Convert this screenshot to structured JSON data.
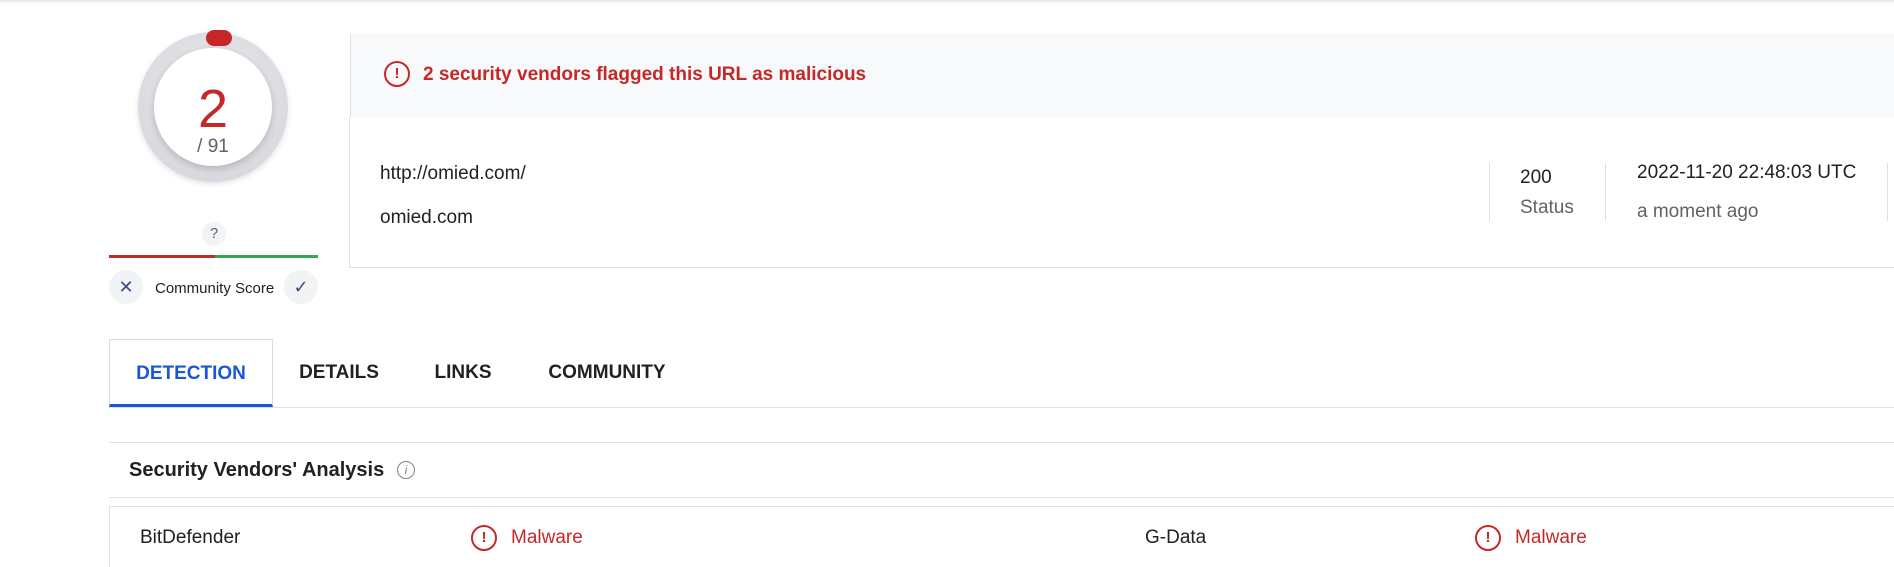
{
  "score": {
    "detections": "2",
    "total": "/ 91"
  },
  "community": {
    "unknown_mark": "?",
    "label": "Community Score",
    "vote_down_icon": "✕",
    "vote_up_icon": "✓"
  },
  "alert": {
    "icon": "!",
    "text": "2 security vendors flagged this URL as malicious"
  },
  "target": {
    "url": "http://omied.com/",
    "domain": "omied.com",
    "status_code": "200",
    "status_label": "Status",
    "date": "2022-11-20 22:48:03 UTC",
    "relative_time": "a moment ago"
  },
  "tabs": [
    {
      "label": "DETECTION",
      "active": true
    },
    {
      "label": "DETAILS",
      "active": false
    },
    {
      "label": "LINKS",
      "active": false
    },
    {
      "label": "COMMUNITY",
      "active": false
    }
  ],
  "vendors_section": {
    "title": "Security Vendors' Analysis",
    "info_icon": "i",
    "rows": [
      {
        "left": {
          "vendor": "BitDefender",
          "result": "Malware",
          "icon": "!"
        },
        "right": {
          "vendor": "G-Data",
          "result": "Malware",
          "icon": "!"
        }
      }
    ]
  },
  "colors": {
    "malicious": "#c62828",
    "accent": "#1a57d6",
    "harmless": "#34a853"
  }
}
